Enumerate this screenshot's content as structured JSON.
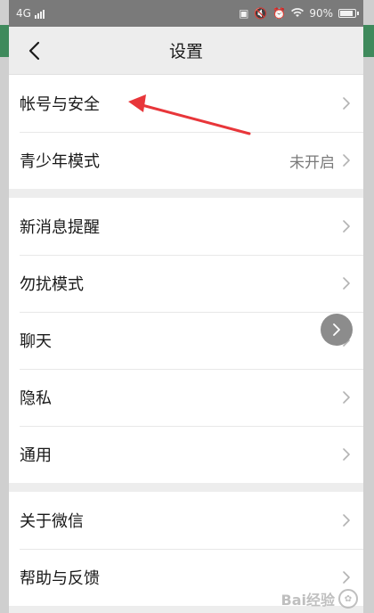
{
  "status_bar": {
    "network": "4G",
    "battery_percent": "90%"
  },
  "header": {
    "title": "设置"
  },
  "groups": [
    {
      "items": [
        {
          "label": "帐号与安全"
        },
        {
          "label": "青少年模式",
          "value": "未开启"
        }
      ]
    },
    {
      "items": [
        {
          "label": "新消息提醒"
        },
        {
          "label": "勿扰模式"
        },
        {
          "label": "聊天"
        },
        {
          "label": "隐私"
        },
        {
          "label": "通用"
        }
      ]
    },
    {
      "items": [
        {
          "label": "关于微信"
        },
        {
          "label": "帮助与反馈"
        }
      ]
    }
  ],
  "watermark": {
    "text": "Bai经验"
  },
  "colors": {
    "annotation_arrow": "#e8363a",
    "status_bar": "#7a7a7a",
    "background": "#ededed"
  }
}
